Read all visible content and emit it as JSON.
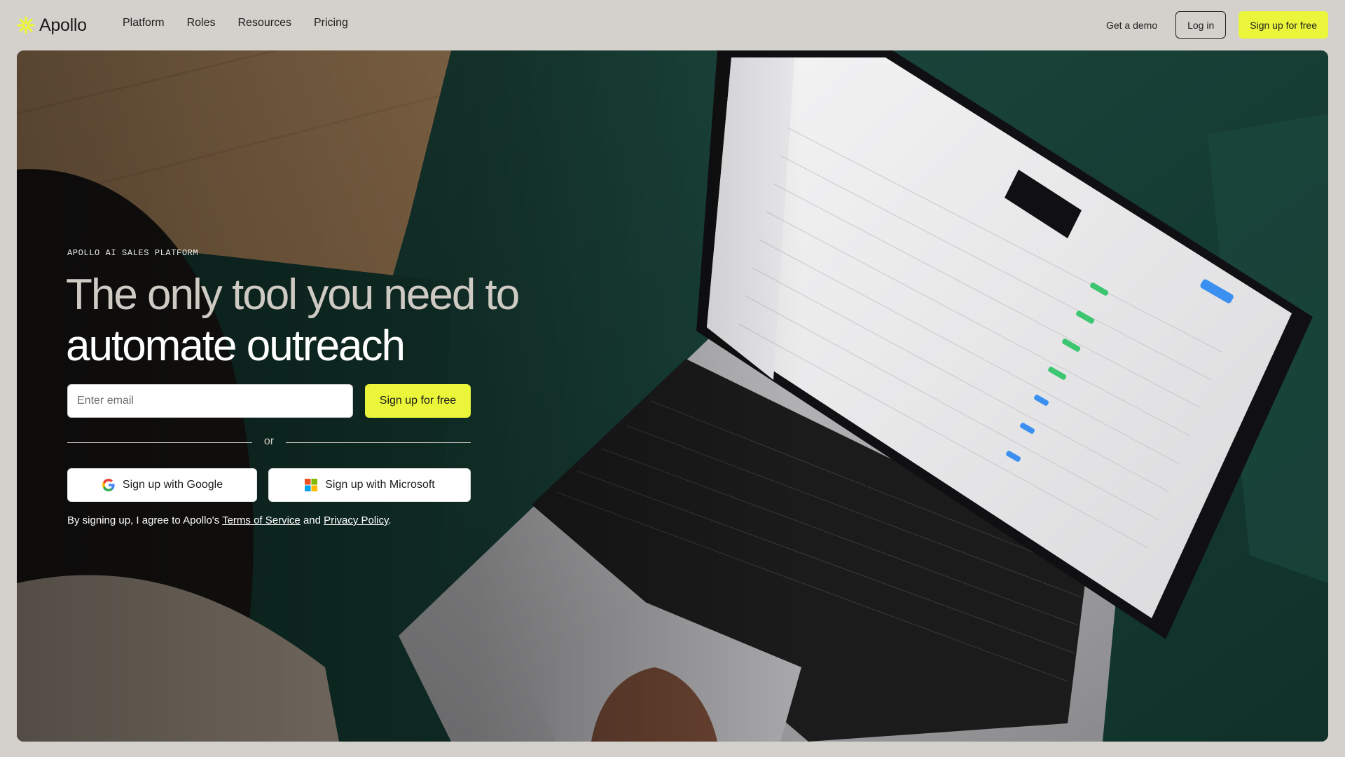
{
  "brand": {
    "name": "Apollo",
    "logo_color": "#ebf53a"
  },
  "nav": {
    "links": [
      "Platform",
      "Roles",
      "Resources",
      "Pricing"
    ],
    "demo_label": "Get a demo",
    "login_label": "Log in",
    "signup_label": "Sign up for free"
  },
  "hero": {
    "eyebrow": "APOLLO AI SALES PLATFORM",
    "headline_soft": "The only tool you need to",
    "headline_strong": "automate outreach",
    "email_placeholder": "Enter email",
    "signup_label": "Sign up for free",
    "or_label": "or",
    "google_label": "Sign up with Google",
    "microsoft_label": "Sign up with Microsoft",
    "terms_prefix": "By signing up, I agree to Apollo's",
    "terms_link": "Terms of Service",
    "terms_and": "and",
    "privacy_link": "Privacy Policy",
    "terms_suffix": "."
  },
  "colors": {
    "accent": "#ebf53a",
    "page_bg": "#d4d0cc"
  }
}
